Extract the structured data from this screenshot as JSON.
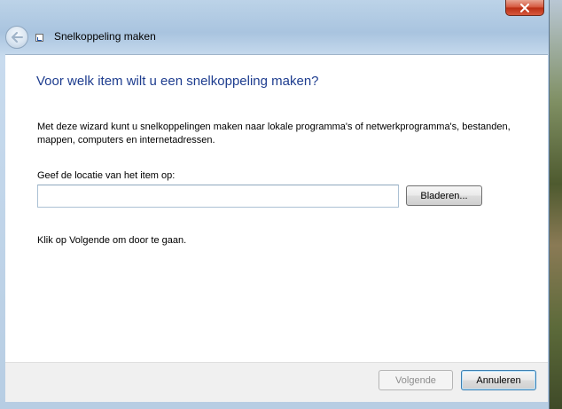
{
  "window": {
    "title": "Snelkoppeling maken",
    "close_icon": "close-icon",
    "back_icon": "back-arrow-icon",
    "app_icon": "shortcut-icon",
    "colors": {
      "heading": "#1e3d8f",
      "close_button": "#c9432a",
      "content_bg": "#ffffff",
      "footer_bg": "#f0f0f0"
    }
  },
  "main": {
    "heading": "Voor welk item wilt u een snelkoppeling maken?",
    "description": "Met deze wizard kunt u snelkoppelingen maken naar lokale programma's of netwerkprogramma's, bestanden, mappen, computers en internetadressen.",
    "location_label": "Geef de locatie van het item op:",
    "location_value": "",
    "browse_label": "Bladeren...",
    "hint": "Klik op Volgende om door te gaan."
  },
  "footer": {
    "next_label": "Volgende",
    "next_enabled": false,
    "cancel_label": "Annuleren"
  }
}
